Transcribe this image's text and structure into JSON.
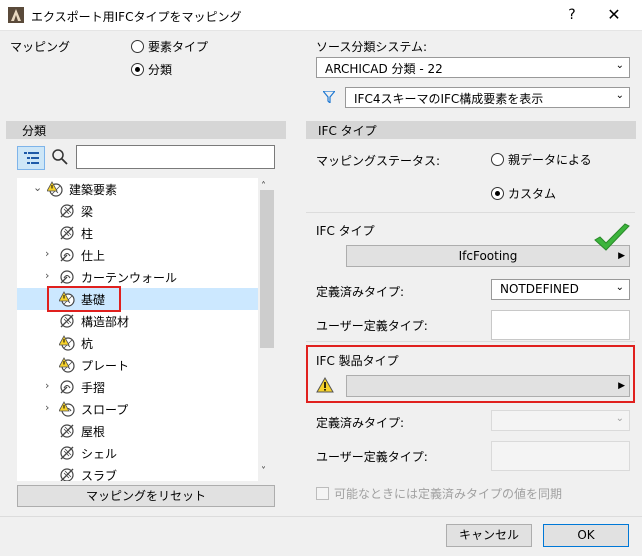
{
  "window": {
    "title": "エクスポート用IFCタイプをマッピング",
    "help_label": "?",
    "close_label": "✕"
  },
  "mapping": {
    "label": "マッピング",
    "options": [
      "要素タイプ",
      "分類"
    ],
    "selected": "分類"
  },
  "source": {
    "label": "ソース分類システム:",
    "system_value": "ARCHICAD 分類 - 22",
    "filter_value": "IFC4スキーマのIFC構成要素を表示"
  },
  "left_panel": {
    "header": "分類",
    "search_placeholder": "",
    "reset_button": "マッピングをリセット",
    "tree": [
      {
        "label": "建築要素",
        "expander": "down",
        "icon": "warning-hatched-icon",
        "level": 1
      },
      {
        "label": "梁",
        "expander": "",
        "icon": "hatched-slash-icon",
        "level": 2
      },
      {
        "label": "柱",
        "expander": "",
        "icon": "hatched-slash-icon",
        "level": 2
      },
      {
        "label": "仕上",
        "expander": "right",
        "icon": "override-icon",
        "level": 2
      },
      {
        "label": "カーテンウォール",
        "expander": "right",
        "icon": "override-icon",
        "level": 2
      },
      {
        "label": "基礎",
        "expander": "",
        "icon": "warning-hatched-icon",
        "level": 2,
        "selected": true
      },
      {
        "label": "構造部材",
        "expander": "",
        "icon": "hatched-slash-icon",
        "level": 2
      },
      {
        "label": "杭",
        "expander": "",
        "icon": "warning-hatched-icon",
        "level": 2
      },
      {
        "label": "プレート",
        "expander": "",
        "icon": "warning-hatched-icon",
        "level": 2
      },
      {
        "label": "手摺",
        "expander": "right",
        "icon": "override-icon",
        "level": 2
      },
      {
        "label": "スロープ",
        "expander": "right",
        "icon": "warning-override-icon",
        "level": 2
      },
      {
        "label": "屋根",
        "expander": "",
        "icon": "hatched-slash-icon",
        "level": 2
      },
      {
        "label": "シェル",
        "expander": "",
        "icon": "hatched-slash-icon",
        "level": 2
      },
      {
        "label": "スラブ",
        "expander": "",
        "icon": "hatched-slash-icon",
        "level": 2
      }
    ]
  },
  "right_panel": {
    "header": "IFC タイプ",
    "status_label": "マッピングステータス:",
    "status_options": [
      "親データによる",
      "カスタム"
    ],
    "status_selected": "カスタム",
    "ifc_type_label": "IFC タイプ",
    "ifc_type_value": "IfcFooting",
    "predefined_label": "定義済みタイプ:",
    "predefined_value": "NOTDEFINED",
    "user_defined_label": "ユーザー定義タイプ:",
    "product_label": "IFC 製品タイプ",
    "product_value": "",
    "predefined2_label": "定義済みタイプ:",
    "user_defined2_label": "ユーザー定義タイプ:",
    "sync_label": "可能なときには定義済みタイプの値を同期",
    "sync_checked": false
  },
  "footer": {
    "cancel": "キャンセル",
    "ok": "OK"
  },
  "colors": {
    "highlight_red": "#e0201e",
    "selection_blue": "#cce8ff",
    "check_green": "#3cb43c",
    "warning_yellow": "#f7d22a"
  }
}
